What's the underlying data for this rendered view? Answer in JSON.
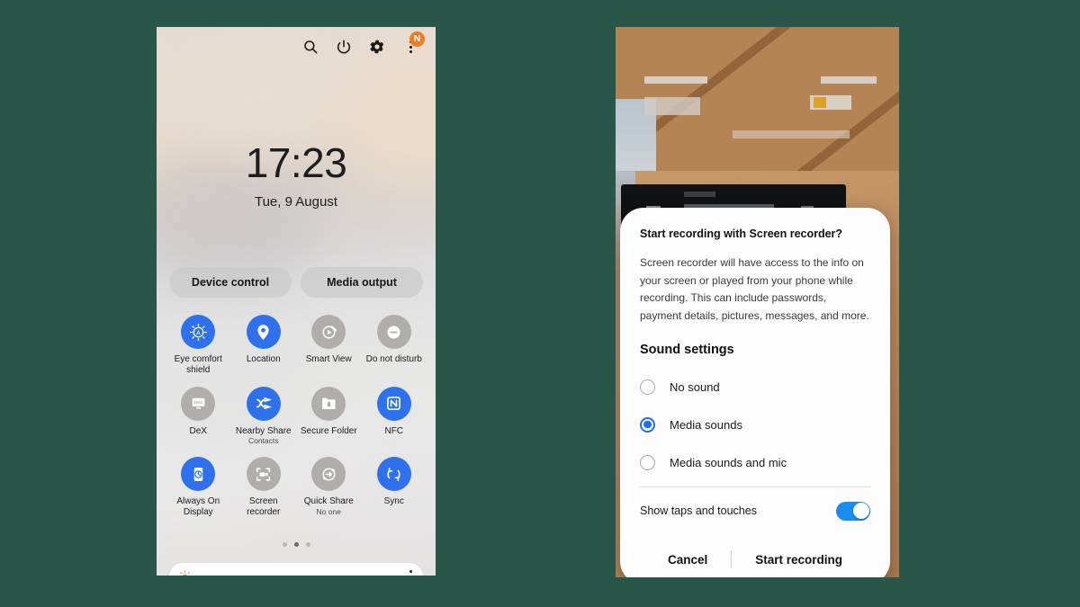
{
  "background_color": "#2a5549",
  "left_phone": {
    "name": "quick-settings-panel",
    "status_icons": [
      {
        "name": "search-icon",
        "glyph": "search"
      },
      {
        "name": "power-icon",
        "glyph": "power"
      },
      {
        "name": "settings-gear-icon",
        "glyph": "gear"
      },
      {
        "name": "overflow-menu-icon",
        "glyph": "kebab"
      }
    ],
    "badge_letter": "N",
    "badge_color": "#f07c1f",
    "clock": {
      "time": "17:23",
      "date": "Tue, 9 August"
    },
    "buttons": {
      "device_control": "Device control",
      "media_output": "Media output"
    },
    "toggles": [
      {
        "label": "Eye comfort shield",
        "sub": "",
        "state": "on",
        "icon": "eye-comfort-shield-icon"
      },
      {
        "label": "Location",
        "sub": "",
        "state": "on",
        "icon": "location-pin-icon"
      },
      {
        "label": "Smart View",
        "sub": "",
        "state": "off",
        "icon": "smart-view-icon"
      },
      {
        "label": "Do not disturb",
        "sub": "",
        "state": "off",
        "icon": "do-not-disturb-icon"
      },
      {
        "label": "DeX",
        "sub": "",
        "state": "off",
        "icon": "dex-icon"
      },
      {
        "label": "Nearby Share",
        "sub": "Contacts",
        "state": "on",
        "icon": "nearby-share-icon"
      },
      {
        "label": "Secure Folder",
        "sub": "",
        "state": "off",
        "icon": "secure-folder-icon"
      },
      {
        "label": "NFC",
        "sub": "",
        "state": "on",
        "icon": "nfc-icon"
      },
      {
        "label": "Always On Display",
        "sub": "",
        "state": "on",
        "icon": "always-on-display-icon"
      },
      {
        "label": "Screen recorder",
        "sub": "",
        "state": "off",
        "icon": "screen-recorder-icon"
      },
      {
        "label": "Quick Share",
        "sub": "No one",
        "state": "off",
        "icon": "quick-share-icon"
      },
      {
        "label": "Sync",
        "sub": "",
        "state": "on",
        "icon": "sync-icon"
      }
    ],
    "page_dots": {
      "count": 3,
      "active_index": 1
    },
    "brightness": {
      "icon": "brightness-sun-icon",
      "value_percent": 2,
      "menu_icon": "brightness-options-icon"
    },
    "accent_on_color": "#2f71ed",
    "accent_off_color": "#b0aeab"
  },
  "right_phone": {
    "name": "screen-recorder-dialog-screen",
    "dialog": {
      "title": "Start recording with Screen recorder?",
      "body": "Screen recorder will have access to the info on your screen or played from your phone while recording. This can include passwords, payment details, pictures, messages, and more.",
      "section_heading": "Sound settings",
      "options": [
        {
          "label": "No sound",
          "selected": false
        },
        {
          "label": "Media sounds",
          "selected": true
        },
        {
          "label": "Media sounds and mic",
          "selected": false
        }
      ],
      "switch": {
        "label": "Show taps and touches",
        "on": true,
        "color": "#1a8cf0"
      },
      "actions": {
        "cancel": "Cancel",
        "confirm": "Start recording"
      },
      "selected_radio_color": "#1a73e8"
    }
  }
}
